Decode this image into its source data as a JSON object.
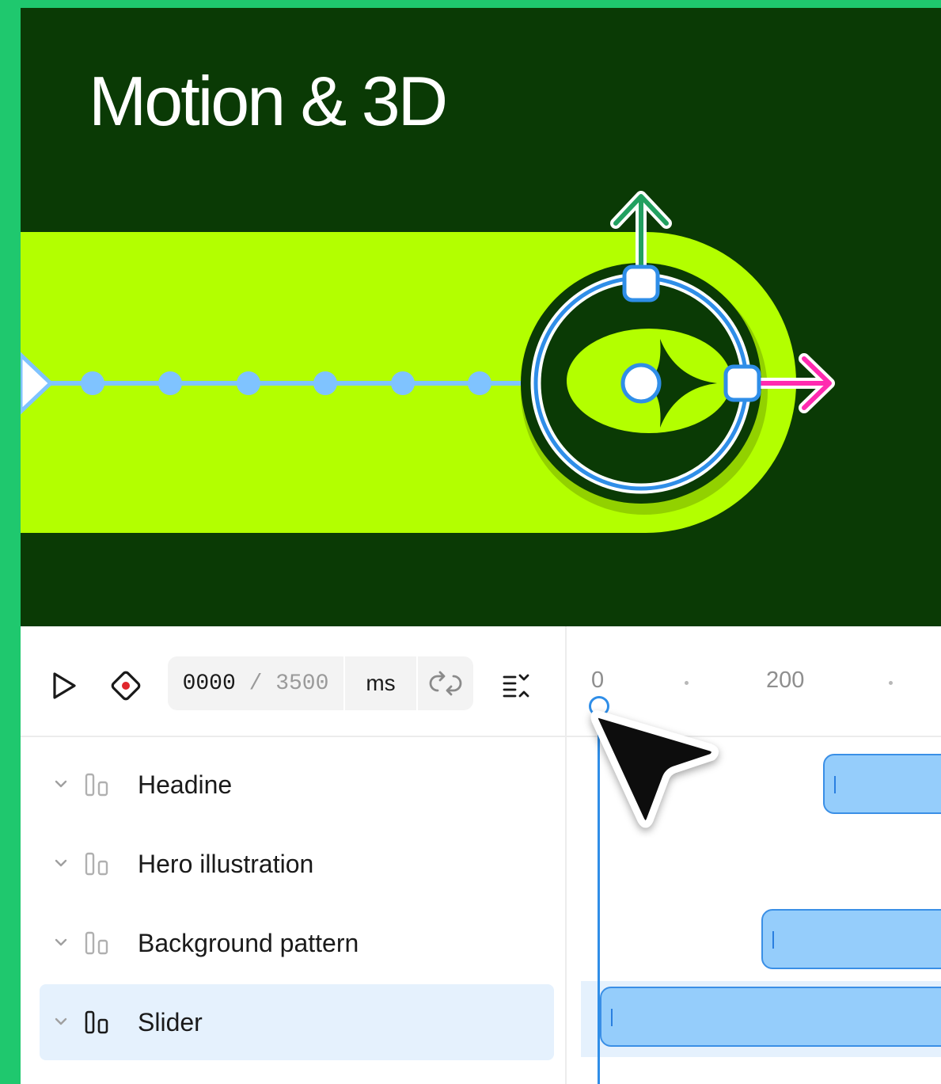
{
  "canvas": {
    "title": "Motion & 3D",
    "colors": {
      "background": "#0a3a05",
      "slider_fill": "#b3ff00",
      "path": "#7fc3ff",
      "selection": "#2f8ee8",
      "y_axis_arrow": "#22a060",
      "x_axis_arrow": "#ff2ab0"
    }
  },
  "toolbar": {
    "play_icon": "play-icon",
    "record_icon": "record-keyframe-icon",
    "time_current": "0000",
    "time_separator": " / ",
    "time_total": "3500",
    "unit": "ms",
    "loop_icon": "loop-icon",
    "sort_icon": "sort-icon"
  },
  "ruler": {
    "ticks": [
      "0",
      "200"
    ]
  },
  "layers": [
    {
      "name": "Headine",
      "selected": false
    },
    {
      "name": "Hero illustration",
      "selected": false
    },
    {
      "name": "Background pattern",
      "selected": false
    },
    {
      "name": "Slider",
      "selected": true
    }
  ]
}
